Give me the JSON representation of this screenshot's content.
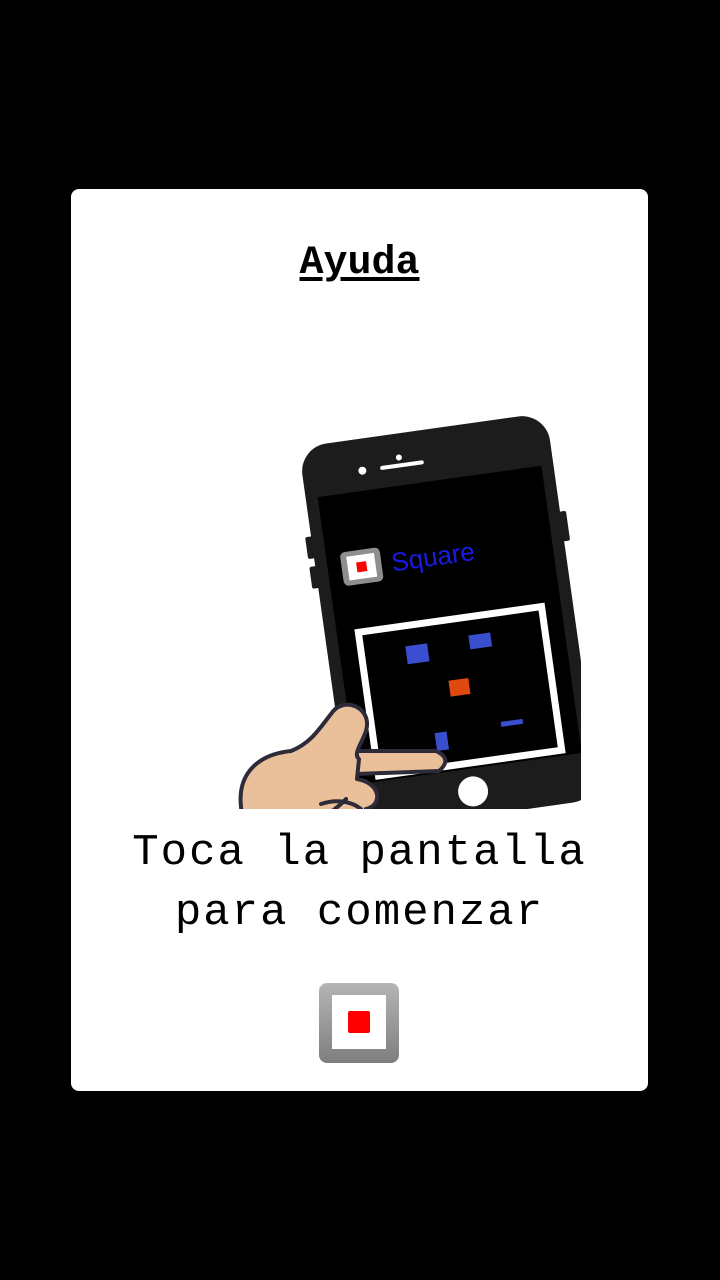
{
  "help": {
    "title": "Ayuda",
    "instruction_line1": "Toca la pantalla",
    "instruction_line2": "para comenzar"
  },
  "phone_screen": {
    "app_name": "Square"
  },
  "colors": {
    "background": "#000000",
    "card": "#ffffff",
    "brand_red": "#ff0000",
    "logo_blue": "#1a1ae6",
    "enemy_blue": "#3a4fd0",
    "player_orange": "#e04a10"
  }
}
